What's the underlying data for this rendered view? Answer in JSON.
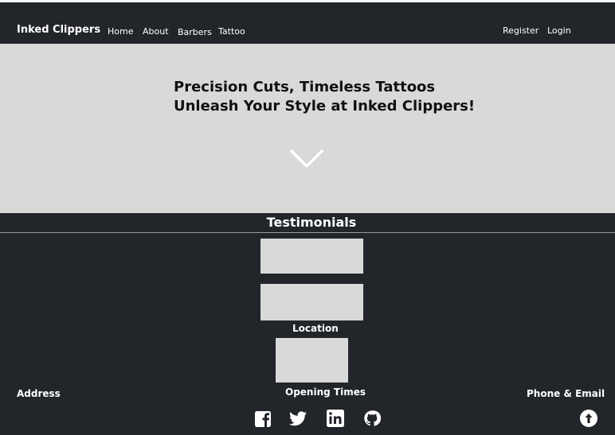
{
  "navbar": {
    "brand": "Inked Clippers",
    "links": [
      "Home",
      "About",
      "Barbers",
      "Tattoo"
    ],
    "auth": {
      "register": "Register",
      "login": "Login"
    }
  },
  "hero": {
    "line1": "Precision Cuts, Timeless Tattoos",
    "line2": "Unleash Your Style at Inked Clippers!",
    "scroll_icon": "chevron-down-icon"
  },
  "testimonials": {
    "title": "Testimonials"
  },
  "location": {
    "title": "Location"
  },
  "footer": {
    "address_label": "Address",
    "opening_label": "Opening Times",
    "contact_label": "Phone & Email",
    "social_icons": [
      "facebook-icon",
      "twitter-icon",
      "linkedin-icon",
      "github-icon"
    ],
    "back_to_top_icon": "arrow-up-icon"
  },
  "colors": {
    "background": "#22252a",
    "placeholder": "#d9d9d9",
    "hero_text": "#111111",
    "text": "#ffffff"
  }
}
